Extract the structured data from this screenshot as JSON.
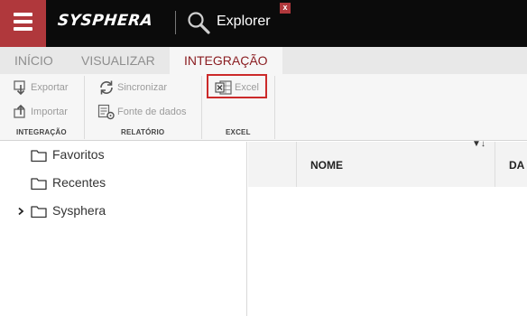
{
  "header": {
    "brand": "SYSPHERA",
    "app_title": "Explorer",
    "close_badge": "x",
    "brand_color": "#b0383c"
  },
  "tabs": [
    {
      "label": "INÍCIO",
      "active": false
    },
    {
      "label": "VISUALIZAR",
      "active": false
    },
    {
      "label": "INTEGRAÇÃO",
      "active": true
    }
  ],
  "ribbon": {
    "groups": [
      {
        "label": "INTEGRAÇÃO",
        "items": [
          {
            "label": "Exportar",
            "icon": "export-icon"
          },
          {
            "label": "Importar",
            "icon": "import-icon"
          }
        ]
      },
      {
        "label": "RELATÓRIO",
        "items": [
          {
            "label": "Sincronizar",
            "icon": "sync-icon"
          },
          {
            "label": "Fonte de dados",
            "icon": "data-source-icon"
          }
        ]
      },
      {
        "label": "EXCEL",
        "items": [
          {
            "label": "Excel",
            "icon": "excel-icon",
            "highlighted": true
          }
        ]
      }
    ]
  },
  "tree": {
    "items": [
      {
        "label": "Favoritos",
        "expandable": false
      },
      {
        "label": "Recentes",
        "expandable": false
      },
      {
        "label": "Sysphera",
        "expandable": true
      }
    ]
  },
  "grid": {
    "columns": [
      "NOME",
      "DA"
    ],
    "filter_sort_glyph": "▼↓"
  }
}
